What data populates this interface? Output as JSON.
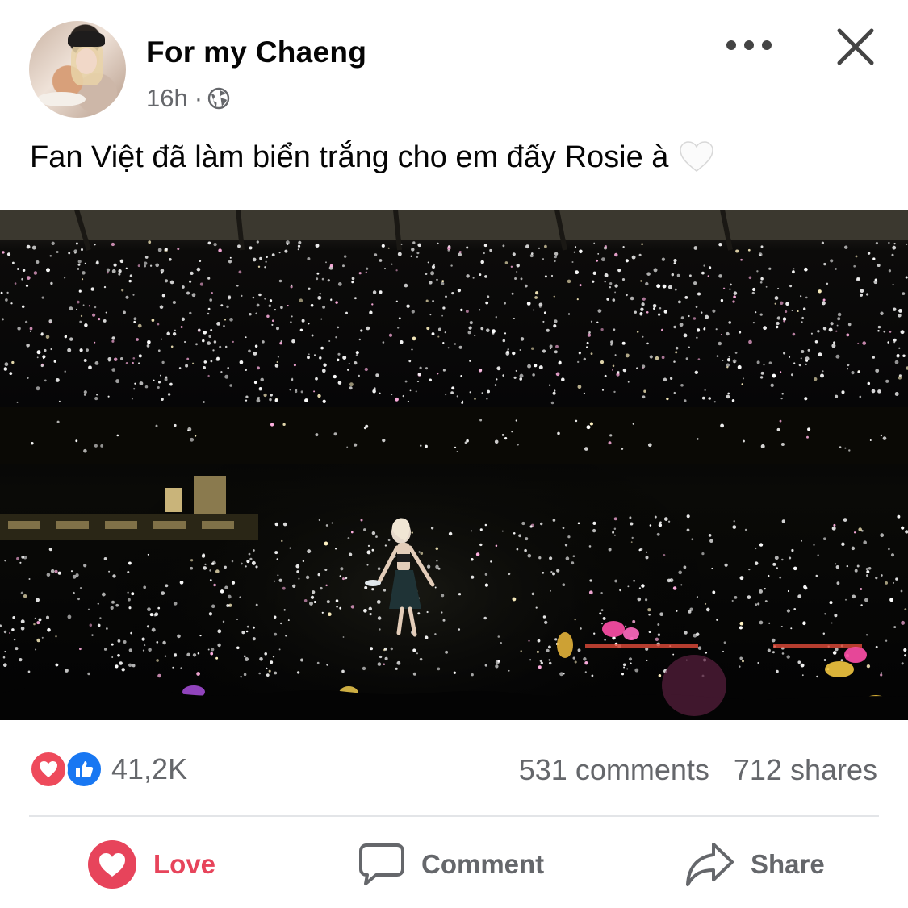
{
  "post": {
    "author": "For my Chaeng",
    "time": "16h",
    "separator": "·",
    "text": "Fan Việt đã làm biển trắng cho em đấy Rosie à",
    "icons": {
      "more": "more-dots-icon",
      "close": "close-icon",
      "audience": "globe-icon",
      "emoji": "white-heart-emoji"
    }
  },
  "stats": {
    "reaction_count": "41,2K",
    "comments": "531 comments",
    "shares": "712 shares"
  },
  "actions": {
    "love": "Love",
    "comment": "Comment",
    "share": "Share"
  },
  "colors": {
    "love": "#e7445b",
    "like": "#1877f2",
    "secondary_text": "#65676b"
  }
}
